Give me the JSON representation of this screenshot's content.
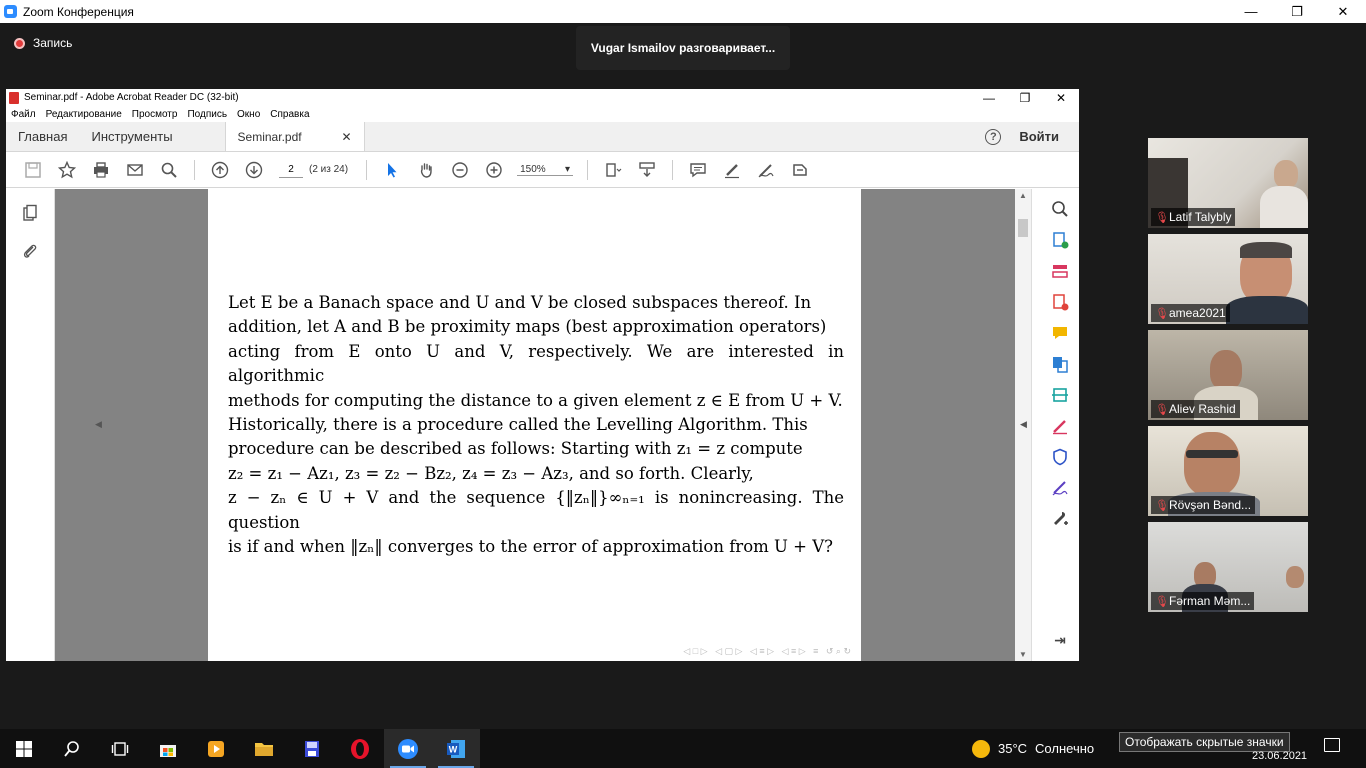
{
  "zoom": {
    "title": "Zoom Конференция",
    "recording_label": "Запись",
    "speaker_toast": "Vugar Ismailov разговаривает...",
    "window_controls": {
      "minimize": "—",
      "restore": "❐",
      "close": "✕"
    }
  },
  "acrobat": {
    "title": "Seminar.pdf - Adobe Acrobat Reader DC (32-bit)",
    "menu": [
      "Файл",
      "Редактирование",
      "Просмотр",
      "Подпись",
      "Окно",
      "Справка"
    ],
    "tabs": {
      "home": "Главная",
      "tools": "Инструменты",
      "document": "Seminar.pdf"
    },
    "help": "?",
    "login": "Войти",
    "page_number": "2",
    "page_count": "(2 из 24)",
    "zoom_level": "150%",
    "page_text_lines": [
      "Let E be a Banach space and U and V be closed subspaces thereof. In",
      "addition, let A and B be proximity maps (best approximation operators)",
      "acting from E onto U and V, respectively. We are interested in algorithmic",
      "methods for computing the distance to a given element z ∈ E from U + V.",
      "Historically, there is a procedure called the Levelling Algorithm. This",
      "procedure can be described as follows: Starting with z₁ = z compute",
      "z₂ = z₁ − Az₁, z₃ = z₂ − Bz₂, z₄ = z₃ − Az₃, and so forth. Clearly,",
      "z − zₙ ∈ U + V and the sequence {‖zₙ‖}∞ₙ₌₁ is nonincreasing. The question",
      "is if and when ‖zₙ‖ converges to the error of approximation from U + V?"
    ]
  },
  "participants": [
    {
      "name": "Latif Talybly",
      "muted": true
    },
    {
      "name": "amea2021",
      "muted": true
    },
    {
      "name": "Aliev Rashid",
      "muted": true
    },
    {
      "name": "Rövşən Bənd...",
      "muted": true
    },
    {
      "name": "Fərman Məm...",
      "muted": true
    }
  ],
  "taskbar": {
    "weather_temp": "35°C",
    "weather_text": "Солнечно",
    "tooltip": "Отображать скрытые значки",
    "date": "23.06.2021"
  },
  "colors": {
    "zoom_blue": "#2d8cff",
    "rec_red": "#e23c3c",
    "pdf_red": "#d9302c",
    "muted_red": "#e8484b"
  }
}
